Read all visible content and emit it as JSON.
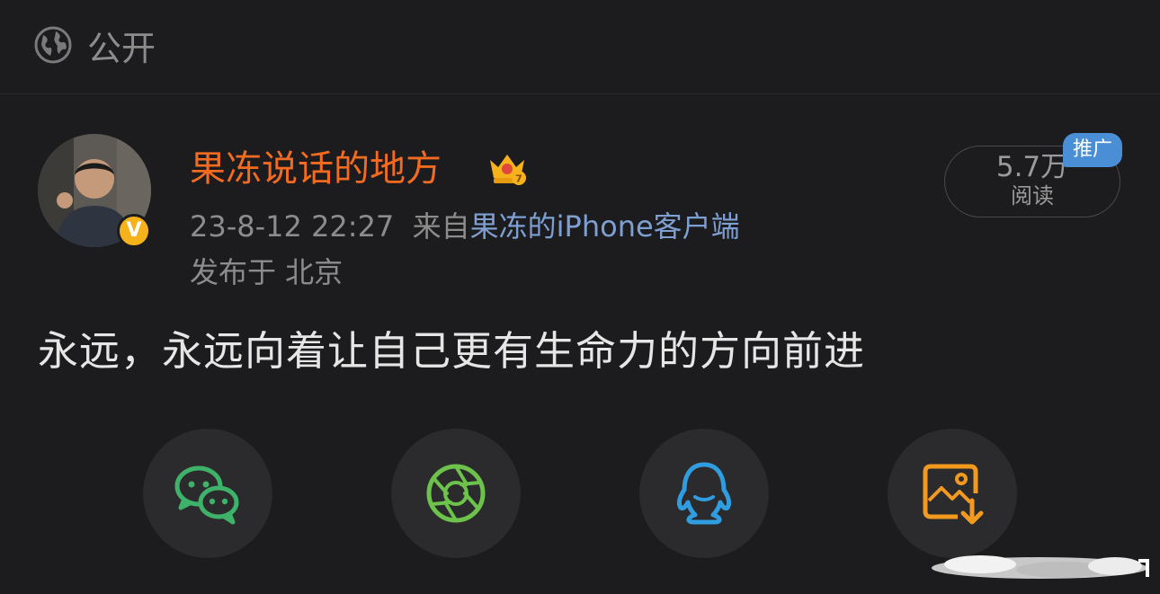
{
  "visibility": {
    "icon": "globe-icon",
    "label": "公开"
  },
  "post": {
    "author": {
      "name": "果冻说话的地方",
      "verified_mark": "V",
      "badge_icon": "crown-icon"
    },
    "timestamp": "23-8-12 22:27",
    "source_prefix": "来自",
    "source_name": "果冻的iPhone客户端",
    "location": "发布于 北京",
    "read_count": "5.7万",
    "read_label": "阅读",
    "promo_badge": "推广",
    "text": "永远，永远向着让自己更有生命力的方向前进"
  },
  "share_buttons": [
    {
      "name": "wechat-icon",
      "color": "#3fb26a"
    },
    {
      "name": "moments-icon",
      "color": "#6cc24a"
    },
    {
      "name": "qq-icon",
      "color": "#2f9de0"
    },
    {
      "name": "save-image-icon",
      "color": "#f29a1f"
    }
  ],
  "colors": {
    "background": "#1c1c1e",
    "username": "#f26b21",
    "link": "#7d9fd1",
    "muted": "#8c8c8c",
    "badge": "#4a8fd6"
  }
}
